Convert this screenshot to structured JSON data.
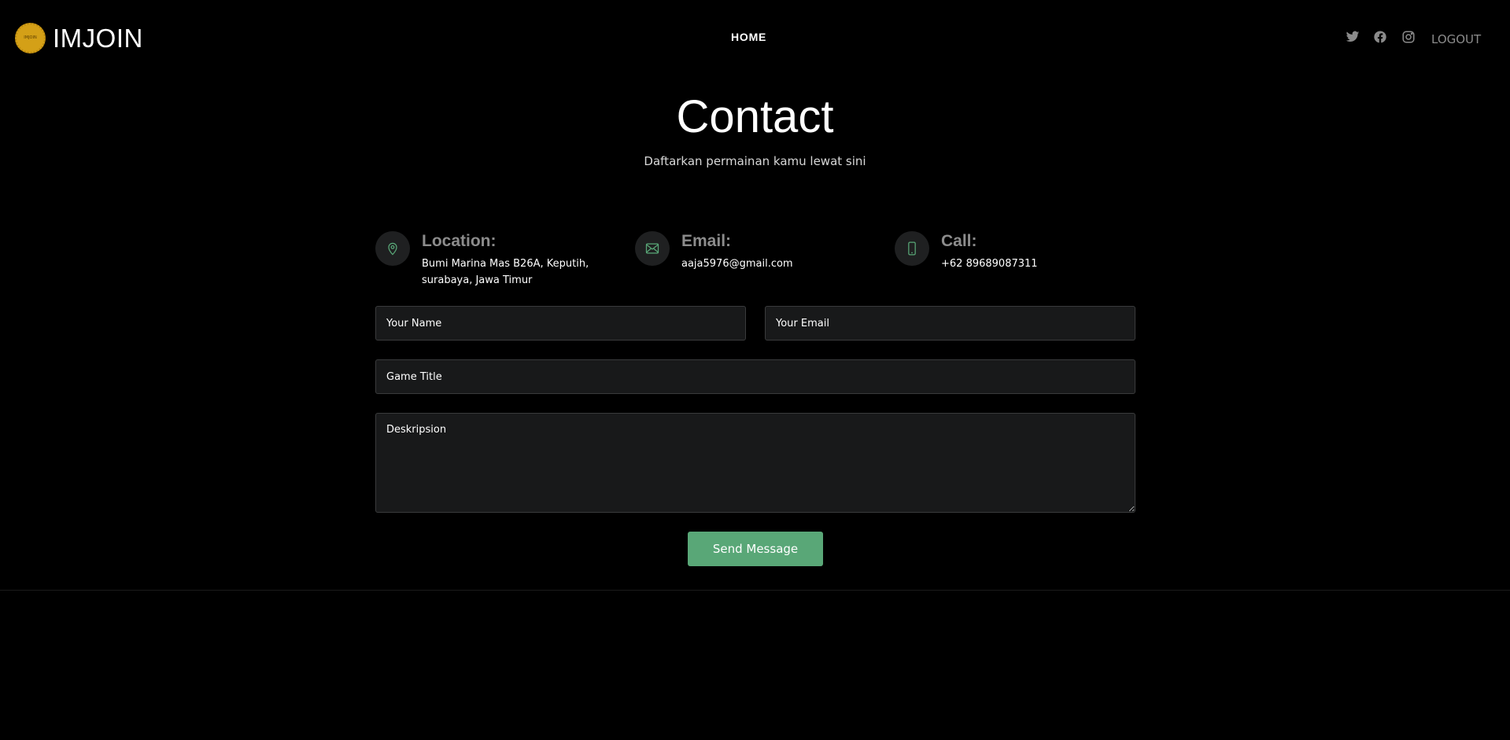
{
  "header": {
    "logo_badge_text": "IMJOIN",
    "logo_text": "IMJOIN",
    "nav_home": "HOME",
    "logout": "LOGOUT",
    "social_icons": [
      "twitter-icon",
      "facebook-icon",
      "instagram-icon"
    ]
  },
  "main": {
    "title": "Contact",
    "subtitle": "Daftarkan permainan kamu lewat sini"
  },
  "info": {
    "location": {
      "heading": "Location:",
      "body": "Bumi Marina Mas B26A, Keputih, surabaya, Jawa Timur",
      "icon": "map-pin-icon"
    },
    "email": {
      "heading": "Email:",
      "body": "aaja5976@gmail.com",
      "icon": "envelope-icon"
    },
    "call": {
      "heading": "Call:",
      "body": "+62 89689087311",
      "icon": "phone-icon"
    }
  },
  "form": {
    "name_placeholder": "Your Name",
    "email_placeholder": "Your Email",
    "game_title_placeholder": "Game Title",
    "description_placeholder": "Deskripsion",
    "send_label": "Send Message"
  },
  "colors": {
    "background": "#000000",
    "accent": "#59a777",
    "field_bg": "#18191a",
    "muted_text": "#8c8c8c"
  }
}
